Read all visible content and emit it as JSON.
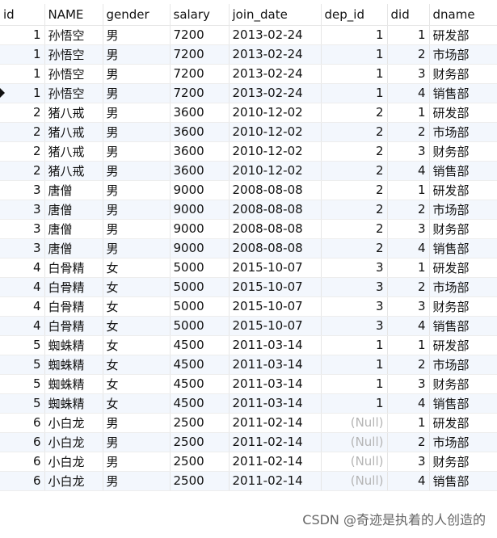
{
  "table": {
    "headers": [
      "id",
      "NAME",
      "gender",
      "salary",
      "join_date",
      "dep_id",
      "did",
      "dname"
    ],
    "rows": [
      [
        "1",
        "孙悟空",
        "男",
        "7200",
        "2013-02-24",
        "1",
        "1",
        "研发部"
      ],
      [
        "1",
        "孙悟空",
        "男",
        "7200",
        "2013-02-24",
        "1",
        "2",
        "市场部"
      ],
      [
        "1",
        "孙悟空",
        "男",
        "7200",
        "2013-02-24",
        "1",
        "3",
        "财务部"
      ],
      [
        "1",
        "孙悟空",
        "男",
        "7200",
        "2013-02-24",
        "1",
        "4",
        "销售部"
      ],
      [
        "2",
        "猪八戒",
        "男",
        "3600",
        "2010-12-02",
        "2",
        "1",
        "研发部"
      ],
      [
        "2",
        "猪八戒",
        "男",
        "3600",
        "2010-12-02",
        "2",
        "2",
        "市场部"
      ],
      [
        "2",
        "猪八戒",
        "男",
        "3600",
        "2010-12-02",
        "2",
        "3",
        "财务部"
      ],
      [
        "2",
        "猪八戒",
        "男",
        "3600",
        "2010-12-02",
        "2",
        "4",
        "销售部"
      ],
      [
        "3",
        "唐僧",
        "男",
        "9000",
        "2008-08-08",
        "2",
        "1",
        "研发部"
      ],
      [
        "3",
        "唐僧",
        "男",
        "9000",
        "2008-08-08",
        "2",
        "2",
        "市场部"
      ],
      [
        "3",
        "唐僧",
        "男",
        "9000",
        "2008-08-08",
        "2",
        "3",
        "财务部"
      ],
      [
        "3",
        "唐僧",
        "男",
        "9000",
        "2008-08-08",
        "2",
        "4",
        "销售部"
      ],
      [
        "4",
        "白骨精",
        "女",
        "5000",
        "2015-10-07",
        "3",
        "1",
        "研发部"
      ],
      [
        "4",
        "白骨精",
        "女",
        "5000",
        "2015-10-07",
        "3",
        "2",
        "市场部"
      ],
      [
        "4",
        "白骨精",
        "女",
        "5000",
        "2015-10-07",
        "3",
        "3",
        "财务部"
      ],
      [
        "4",
        "白骨精",
        "女",
        "5000",
        "2015-10-07",
        "3",
        "4",
        "销售部"
      ],
      [
        "5",
        "蜘蛛精",
        "女",
        "4500",
        "2011-03-14",
        "1",
        "1",
        "研发部"
      ],
      [
        "5",
        "蜘蛛精",
        "女",
        "4500",
        "2011-03-14",
        "1",
        "2",
        "市场部"
      ],
      [
        "5",
        "蜘蛛精",
        "女",
        "4500",
        "2011-03-14",
        "1",
        "3",
        "财务部"
      ],
      [
        "5",
        "蜘蛛精",
        "女",
        "4500",
        "2011-03-14",
        "1",
        "4",
        "销售部"
      ],
      [
        "6",
        "小白龙",
        "男",
        "2500",
        "2011-02-14",
        "(Null)",
        "1",
        "研发部"
      ],
      [
        "6",
        "小白龙",
        "男",
        "2500",
        "2011-02-14",
        "(Null)",
        "2",
        "市场部"
      ],
      [
        "6",
        "小白龙",
        "男",
        "2500",
        "2011-02-14",
        "(Null)",
        "3",
        "财务部"
      ],
      [
        "6",
        "小白龙",
        "男",
        "2500",
        "2011-02-14",
        "(Null)",
        "4",
        "销售部"
      ]
    ],
    "selected_row_index": 3,
    "alternate_row_color": "#f3f7fd",
    "null_text_color": "#b5b5b5"
  },
  "watermark": "CSDN @奇迹是执着的人创造的"
}
